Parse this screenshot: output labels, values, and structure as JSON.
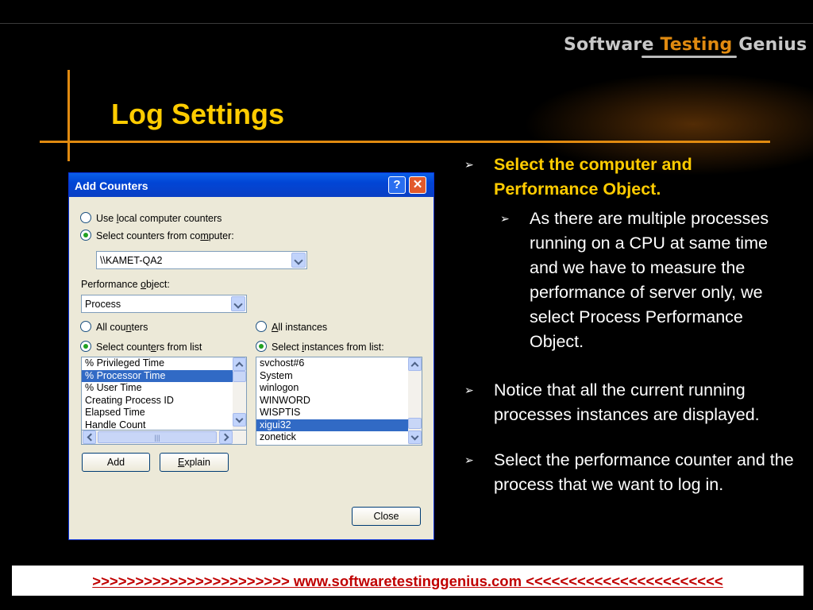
{
  "slide": {
    "logo": {
      "part1": "Software ",
      "part2": "Testing",
      "part3": " Genius"
    },
    "title": "Log Settings",
    "bullets": [
      {
        "level": 1,
        "text": "Select the computer and Performance Object."
      },
      {
        "level": 2,
        "text": "As there are multiple processes running on a CPU at same time and we have to measure the performance of server only, we select Process Performance Object."
      },
      {
        "level": 1,
        "text": "Notice that all the current running processes instances are displayed."
      },
      {
        "level": 1,
        "text": "Select the performance counter and the process that we want to log in."
      }
    ],
    "footer": ">>>>>>>>>>>>>>>>>>>>>>>  www.softwaretestinggenius.com  <<<<<<<<<<<<<<<<<<<<<<<"
  },
  "dialog": {
    "title": "Add Counters",
    "help_label": "?",
    "close_glyph": "✕",
    "radio_local": {
      "pre": "Use ",
      "u": "l",
      "post": "ocal computer counters"
    },
    "radio_select_computer": {
      "pre": "Select counters from co",
      "u": "m",
      "post": "puter:"
    },
    "computer_value": "\\\\KAMET-QA2",
    "perf_object_label": {
      "pre": "Performance ",
      "u": "o",
      "post": "bject:"
    },
    "perf_object_value": "Process",
    "all_counters": {
      "pre": "All cou",
      "u": "n",
      "post": "ters"
    },
    "select_counters": {
      "pre": "Select count",
      "u": "e",
      "post": "rs from list"
    },
    "all_instances": {
      "pre": "",
      "u": "A",
      "post": "ll instances"
    },
    "select_instances": {
      "pre": "Select ",
      "u": "i",
      "post": "nstances from list:"
    },
    "counters": [
      "% Privileged Time",
      "% Processor Time",
      "% User Time",
      "Creating Process ID",
      "Elapsed Time",
      "Handle Count"
    ],
    "counters_selected": 1,
    "instances": [
      "svchost#6",
      "System",
      "winlogon",
      "WINWORD",
      "WISPTIS",
      "xigui32",
      "zonetick"
    ],
    "instances_selected": 5,
    "hscroll_grip": "|||",
    "add_label": "Add",
    "explain_label": {
      "pre": "",
      "u": "E",
      "post": "xplain"
    },
    "close_label": "Close"
  }
}
